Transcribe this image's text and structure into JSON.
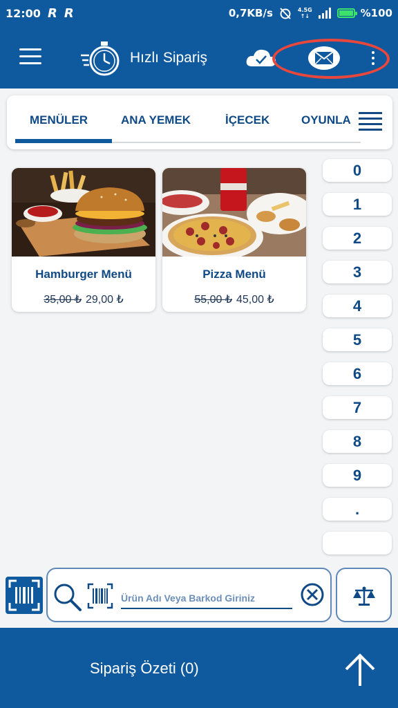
{
  "status_bar": {
    "time": "12:00",
    "r1": "R",
    "r2": "R",
    "net_speed": "0,7KB/s",
    "network_top": "4.5G",
    "network_bottom": "↑↓",
    "battery": "%100"
  },
  "app_bar": {
    "title": "Hızlı Sipariş",
    "icons": [
      "menu-icon",
      "stopwatch-icon",
      "cloud-check-icon",
      "mail-icon",
      "more-vert-icon"
    ],
    "accent": "#0f5a9e",
    "highlight": "#e9473c"
  },
  "tabs": [
    "MENÜLER",
    "ANA YEMEK",
    "İÇECEK",
    "OYUNLA"
  ],
  "active_tab": "MENÜLER",
  "products": [
    {
      "name": "Hamburger Menü",
      "old_price": "35,00 ₺",
      "price": "29,00 ₺"
    },
    {
      "name": "Pizza Menü",
      "old_price": "55,00 ₺",
      "price": "45,00 ₺"
    }
  ],
  "keypad": [
    "0",
    "1",
    "2",
    "3",
    "4",
    "5",
    "6",
    "7",
    "8",
    "9",
    ".",
    ""
  ],
  "search": {
    "placeholder": "Ürün Adı Veya Barkod Giriniz"
  },
  "footer": {
    "label": "Sipariş Özeti (0)"
  }
}
